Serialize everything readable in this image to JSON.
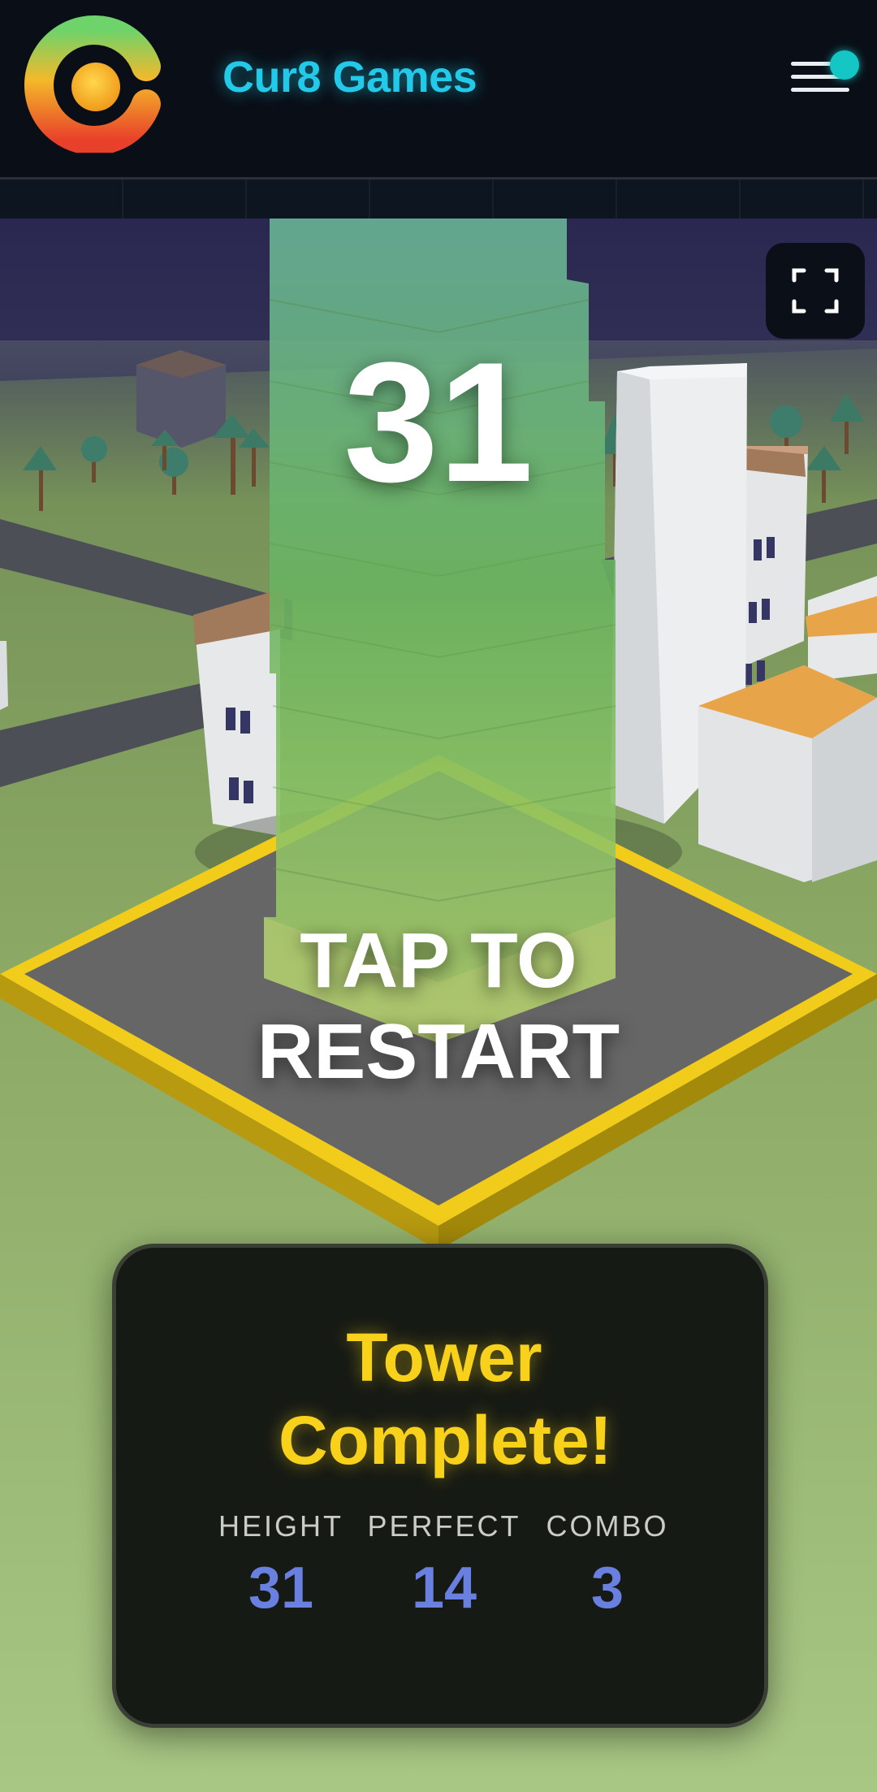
{
  "header": {
    "brand": "Cur8 Games",
    "icons": {
      "logo": "cur8-logo",
      "menu": "hamburger-menu-icon",
      "notification": "notification-dot"
    }
  },
  "game": {
    "score": "31",
    "restart_text": "TAP TO RESTART",
    "fullscreen_icon": "fullscreen-icon"
  },
  "result": {
    "title": "Tower Complete!",
    "stats": [
      {
        "label": "HEIGHT",
        "value": "31"
      },
      {
        "label": "PERFECT",
        "value": "14"
      },
      {
        "label": "COMBO",
        "value": "3"
      }
    ]
  },
  "colors": {
    "brand": "#22c9e8",
    "title": "#f8d21a",
    "stat_value": "#6a80e0",
    "notification": "#14c6c4"
  }
}
